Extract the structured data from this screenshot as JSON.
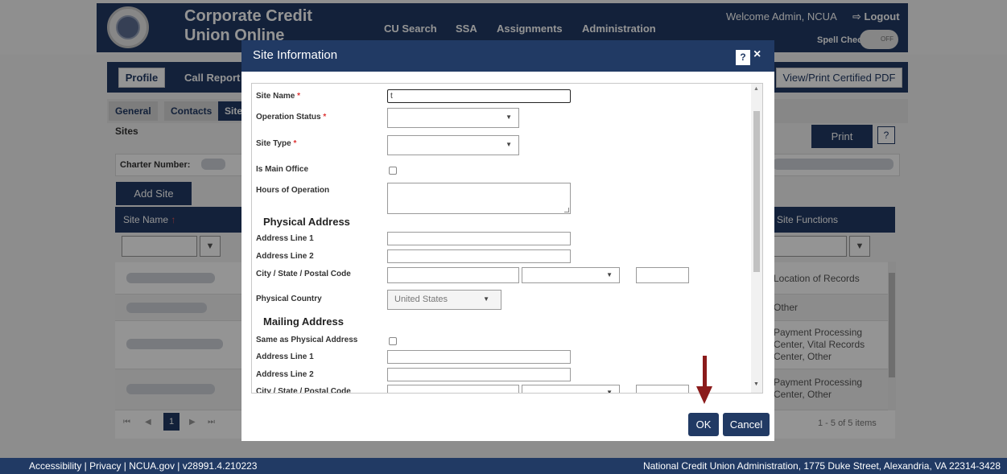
{
  "header": {
    "app_title": "Corporate Credit Union Online",
    "nav": [
      "CU Search",
      "SSA",
      "Assignments",
      "Administration"
    ],
    "welcome": "Welcome Admin, NCUA",
    "logout": "⇨ Logout",
    "spell_check": "Spell Check",
    "spell_toggle": "OFF"
  },
  "tabs": {
    "profile": "Profile",
    "call_report": "Call Report",
    "certified_pdf": "View/Print Certified PDF"
  },
  "subtabs": [
    "General",
    "Contacts",
    "Sites"
  ],
  "sites": {
    "section_label": "Sites",
    "print": "Print",
    "help": "?",
    "charter_label": "Charter Number:",
    "add_site": "Add Site",
    "col_site_name": "Site Name",
    "col_required_mark": "↑",
    "col_site_functions": "Site Functions",
    "rows_functions": [
      "Location of Records",
      "Other",
      "Payment Processing Center, Vital Records Center, Other",
      "Payment Processing Center, Other"
    ],
    "pager_page": "1",
    "pager_info": "1 - 5 of 5 items"
  },
  "footer": {
    "left": "Accessibility | Privacy | NCUA.gov | v28991.4.210223",
    "right": "National Credit Union Administration, 1775 Duke Street, Alexandria, VA 22314-3428"
  },
  "modal": {
    "title": "Site Information",
    "help": "?",
    "close": "×",
    "fields": {
      "site_name": "Site Name",
      "site_name_value": "t",
      "operation_status": "Operation Status",
      "site_type": "Site Type",
      "is_main_office": "Is Main Office",
      "hours": "Hours of Operation",
      "physical_section": "Physical Address",
      "address1": "Address Line 1",
      "address2": "Address Line 2",
      "city_state_zip": "City / State / Postal Code",
      "physical_country": "Physical Country",
      "country_value": "United States",
      "mailing_section": "Mailing Address",
      "same_as_physical": "Same as Physical Address",
      "m_address1": "Address Line 1",
      "m_address2": "Address Line 2",
      "m_city_state_zip": "City / State / Postal Code"
    },
    "required_mark": "*",
    "ok": "OK",
    "cancel": "Cancel"
  },
  "colors": {
    "navy": "#213a64",
    "annotation_arrow": "#8b1b1b",
    "required": "#d33333"
  },
  "icons": [
    "seal-logo",
    "logout-icon",
    "filter-icon",
    "chevron-down-icon",
    "help-icon",
    "close-icon",
    "down-arrow-annotation"
  ]
}
